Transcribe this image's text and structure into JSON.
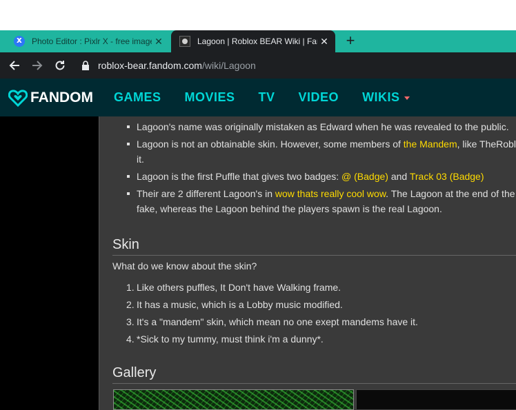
{
  "browser": {
    "tabs": [
      {
        "title": "Photo Editor : Pixlr X - free image editing online",
        "favicon": "pixlr-icon",
        "active": false
      },
      {
        "title": "Lagoon | Roblox BEAR Wiki | Fandom",
        "favicon": "bear-wiki-icon",
        "active": true
      }
    ],
    "new_tab": "+",
    "url_host": "roblox-bear.fandom.com",
    "url_path": "/wiki/Lagoon",
    "tab_color": "#1fb59f"
  },
  "fandom": {
    "logo_text": "FANDOM",
    "nav": [
      "GAMES",
      "MOVIES",
      "TV",
      "VIDEO",
      "WIKIS"
    ],
    "accent": "#00d6d6"
  },
  "trivia": [
    {
      "text": "Lagoon's name was originally mistaken as Edward when he was revealed to the public."
    },
    {
      "pre": "Lagoon is not an obtainable skin. However, some members of ",
      "link": "the Mandem",
      "post": ", like TheRobl",
      "cont": "it."
    },
    {
      "pre": "Lagoon is the first Puffle that gives two badges: ",
      "link": "@ (Badge)",
      "mid": " and ",
      "link2": "Track 03 (Badge)"
    },
    {
      "pre": "Their are 2 different Lagoon's in ",
      "link": "wow thats really cool wow",
      "post": ". The Lagoon at the end of the",
      "cont": "fake, whereas the Lagoon behind the players spawn is the real Lagoon."
    }
  ],
  "skin": {
    "heading": "Skin",
    "intro": "What do we know about the skin?",
    "items": [
      {
        "num": "1.",
        "text": "Like others puffles, It Don't have Walking frame."
      },
      {
        "num": "2.",
        "text": "It has a music, which is a Lobby music modified."
      },
      {
        "num": "3.",
        "text": "It's a \"mandem\" skin, which mean no one exept mandems have it."
      },
      {
        "num": "4.",
        "text": "*Sick to my tummy, must think i'm a dunny*."
      }
    ]
  },
  "gallery": {
    "heading": "Gallery"
  },
  "colors": {
    "link": "#ffdb00",
    "content_bg": "#3a3a3a",
    "header_bg": "#002a32"
  }
}
